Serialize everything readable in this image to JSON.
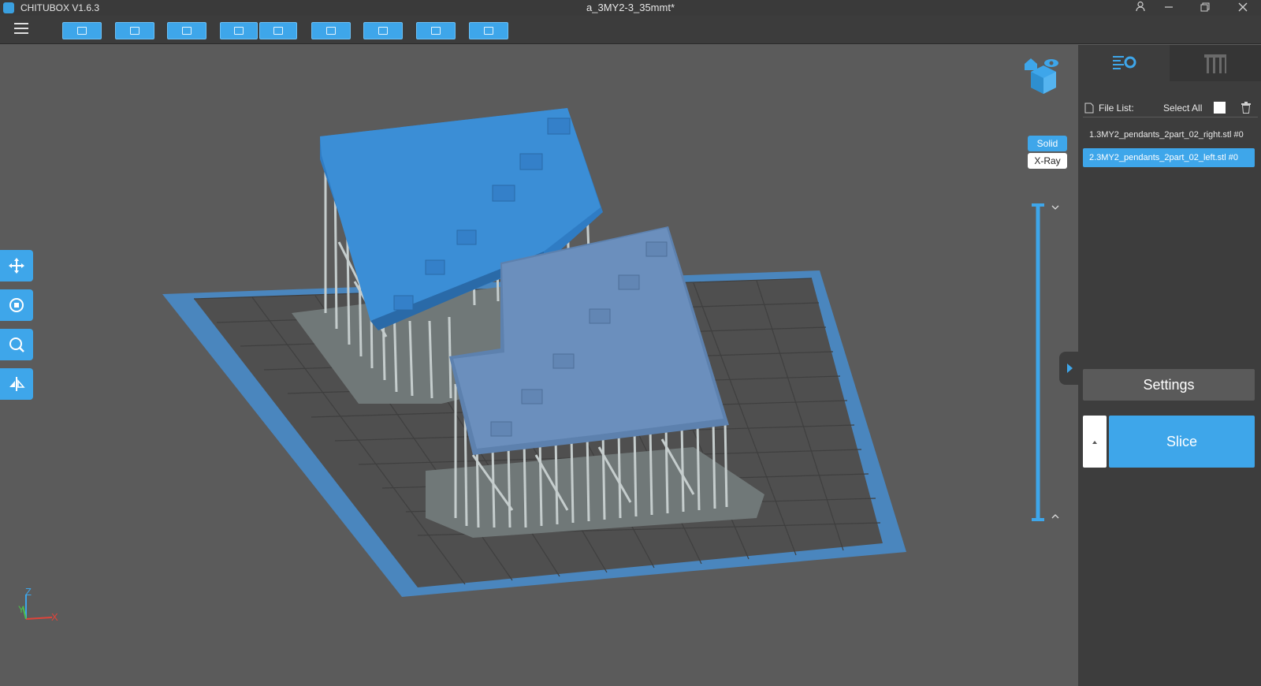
{
  "window": {
    "app_name": "CHITUBOX V1.6.3",
    "document_title": "a_3MY2-3_35mmt*"
  },
  "toolbar": {
    "buttons": [
      "open-file",
      "save",
      "screenshot",
      "undo",
      "redo",
      "copy",
      "arrange",
      "hollow",
      "drill"
    ]
  },
  "view_modes": {
    "solid_label": "Solid",
    "xray_label": "X-Ray",
    "active": "Solid"
  },
  "left_tools": [
    "move",
    "rotate",
    "scale",
    "mirror"
  ],
  "axis": {
    "z": "Z",
    "y": "Y",
    "x": "X"
  },
  "colors": {
    "accent": "#3ea6ea",
    "model_selected": "#3b8ed6",
    "model_other": "#6b8fbd",
    "supports": "#b9c3c3",
    "plate_border": "#4a86be"
  },
  "sidepanel": {
    "file_list_label": "File List:",
    "select_all_label": "Select All",
    "files": [
      {
        "name": "1.3MY2_pendants_2part_02_right.stl #0",
        "selected": false
      },
      {
        "name": "2.3MY2_pendants_2part_02_left.stl #0",
        "selected": true
      }
    ],
    "settings_label": "Settings",
    "slice_label": "Slice"
  }
}
